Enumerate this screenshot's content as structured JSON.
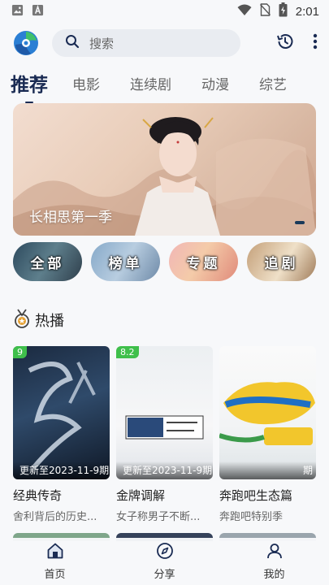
{
  "statusbar": {
    "time": "2:01",
    "icons": [
      "image-icon",
      "a-icon",
      "wifi-icon",
      "no-sim-icon",
      "battery-charging-icon"
    ]
  },
  "topbar": {
    "search_placeholder": "搜索",
    "icons": [
      "app-logo",
      "search-icon",
      "history-icon",
      "more-vert-icon"
    ]
  },
  "tabs": [
    "推荐",
    "电影",
    "连续剧",
    "动漫",
    "综艺"
  ],
  "active_tab": 0,
  "banner": {
    "caption": "长相思第一季"
  },
  "pills": [
    "全部",
    "榜单",
    "专题",
    "追剧"
  ],
  "hot": {
    "title": "热播",
    "cards": [
      {
        "score": "9",
        "update": "更新至2023-11-9期",
        "title": "经典传奇",
        "subtitle": "舍利背后的历史..."
      },
      {
        "score": "8.2",
        "update": "更新至2023-11-9期",
        "title": "金牌调解",
        "subtitle": "女子称男子不断..."
      },
      {
        "score": "",
        "update": "期",
        "title": "奔跑吧生态篇",
        "subtitle": "奔跑吧特别季"
      }
    ]
  },
  "bottom_nav": [
    {
      "label": "首页",
      "icon": "home-icon",
      "active": true
    },
    {
      "label": "分享",
      "icon": "compass-icon",
      "active": false
    },
    {
      "label": "我的",
      "icon": "user-icon",
      "active": false
    }
  ],
  "colors": {
    "accent": "#1a2b53",
    "score_badge": "#3fbf4b",
    "search_bg": "#e9ecf1"
  }
}
